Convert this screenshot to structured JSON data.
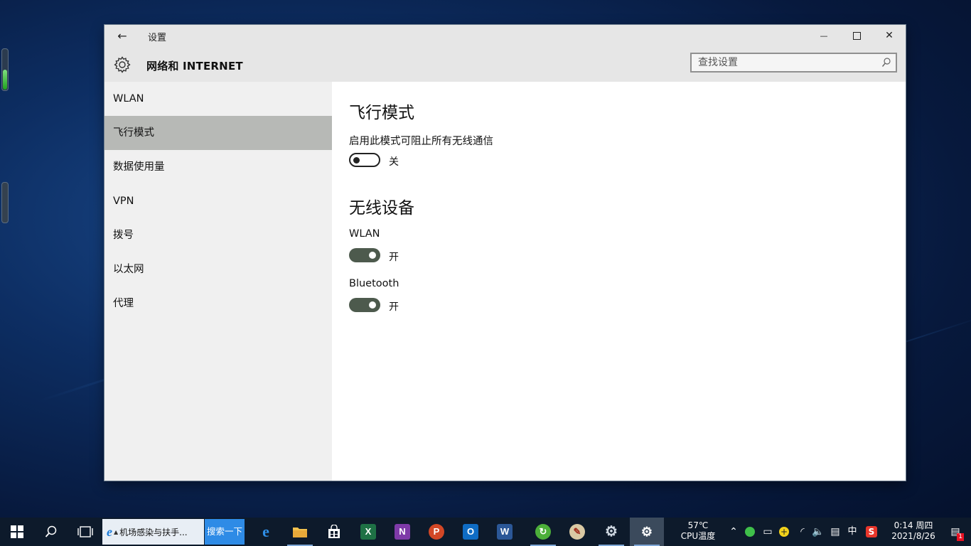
{
  "window": {
    "title": "设置",
    "section": "网络和 INTERNET",
    "search_placeholder": "查找设置",
    "back_glyph": "←",
    "minimize_glyph": "—",
    "close_glyph": "✕"
  },
  "sidebar": {
    "items": [
      {
        "label": "WLAN",
        "active": false
      },
      {
        "label": "飞行模式",
        "active": true
      },
      {
        "label": "数据使用量",
        "active": false
      },
      {
        "label": "VPN",
        "active": false
      },
      {
        "label": "拨号",
        "active": false
      },
      {
        "label": "以太网",
        "active": false
      },
      {
        "label": "代理",
        "active": false
      }
    ]
  },
  "content": {
    "airplane": {
      "heading": "飞行模式",
      "description": "启用此模式可阻止所有无线通信",
      "toggle_state": "关",
      "on": false
    },
    "wireless": {
      "heading": "无线设备",
      "wlan": {
        "label": "WLAN",
        "toggle_state": "开",
        "on": true
      },
      "bluetooth": {
        "label": "Bluetooth",
        "toggle_state": "开",
        "on": true
      }
    }
  },
  "taskbar": {
    "ie_task_label": "机场感染与扶手...",
    "search_button": "搜索一下",
    "apps": [
      "edge",
      "file-explorer",
      "store",
      "excel",
      "onenote",
      "powerpoint",
      "outlook",
      "word",
      "green-app",
      "paint",
      "control-panel",
      "settings"
    ],
    "cpu_temp": "57℃",
    "cpu_label": "CPU温度",
    "ime": "中",
    "time": "0:14 周四",
    "date": "2021/8/26",
    "notification_count": "1",
    "colors": {
      "taskbar_bg": "#0d1a2b",
      "search_button_bg": "#2e8be6",
      "toggle_on": "#4d5a4d",
      "sidebar_active": "#b7b9b6"
    }
  }
}
